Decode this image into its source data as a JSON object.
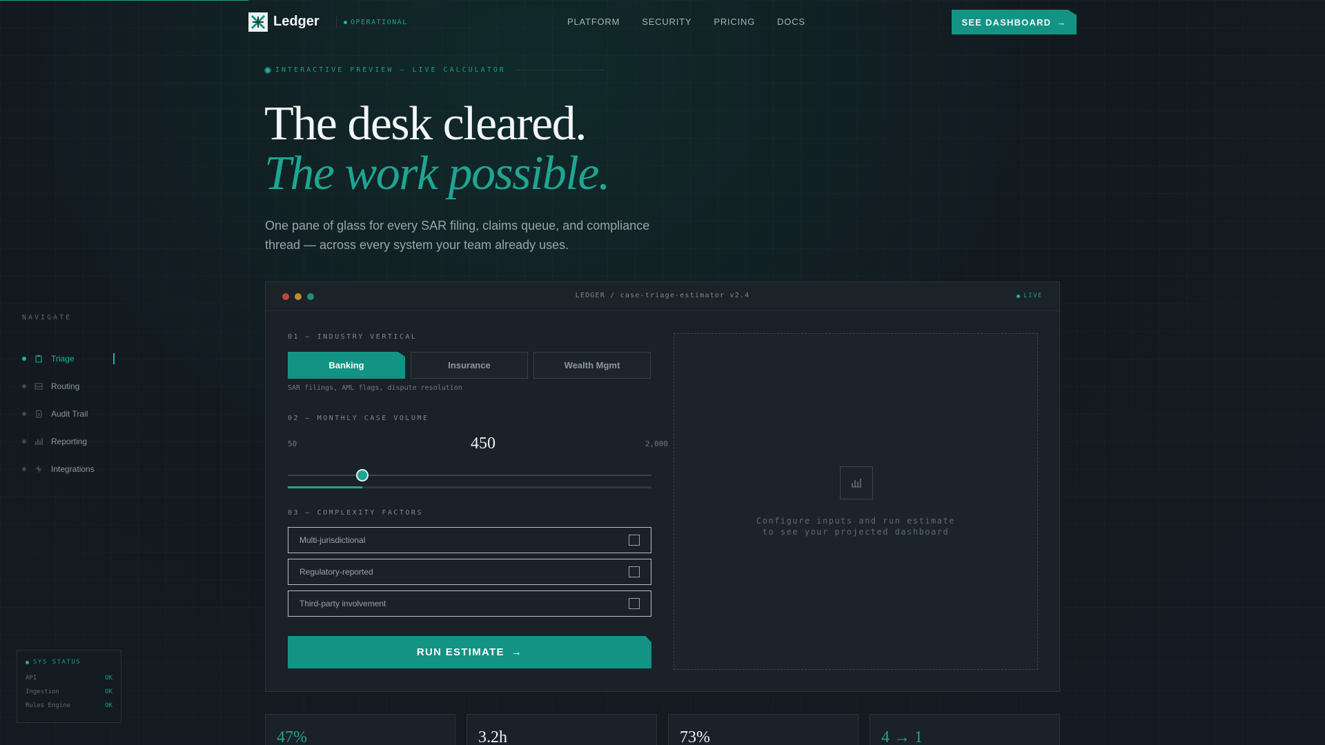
{
  "header": {
    "brand": "Ledger",
    "status": "OPERATIONAL",
    "nav": [
      "PLATFORM",
      "SECURITY",
      "PRICING",
      "DOCS"
    ],
    "cta": "SEE DASHBOARD"
  },
  "hero": {
    "eyebrow": "INTERACTIVE PREVIEW — LIVE CALCULATOR",
    "title_line1": "The desk cleared.",
    "title_line2": "The work possible.",
    "lede": "One pane of glass for every SAR filing, claims queue, and compliance thread — across every system your team already uses."
  },
  "sidebar": {
    "label": "NAVIGATE",
    "items": [
      {
        "label": "Triage",
        "icon": "clipboard-icon",
        "active": true
      },
      {
        "label": "Routing",
        "icon": "inbox-icon",
        "active": false
      },
      {
        "label": "Audit Trail",
        "icon": "document-icon",
        "active": false
      },
      {
        "label": "Reporting",
        "icon": "bar-chart-icon",
        "active": false
      },
      {
        "label": "Integrations",
        "icon": "plug-icon",
        "active": false
      }
    ],
    "sys_status": {
      "title": "SYS STATUS",
      "rows": [
        {
          "name": "API",
          "value": "OK"
        },
        {
          "name": "Ingestion",
          "value": "OK"
        },
        {
          "name": "Rules Engine",
          "value": "OK"
        }
      ]
    }
  },
  "panel": {
    "title": "LEDGER / case-triage-estimator v2.4",
    "live": "LIVE",
    "section1": "01 — INDUSTRY VERTICAL",
    "tabs": [
      "Banking",
      "Insurance",
      "Wealth Mgmt"
    ],
    "active_tab": "Banking",
    "tab_hint": "SAR filings, AML flags, dispute resolution",
    "section2": "02 — MONTHLY CASE VOLUME",
    "volume": {
      "min": "50",
      "max": "2,000",
      "value": "450",
      "slider_fraction": 0.205
    },
    "section3": "03 — COMPLEXITY FACTORS",
    "factors": [
      {
        "label": "Multi-jurisdictional",
        "checked": false
      },
      {
        "label": "Regulatory-reported",
        "checked": false
      },
      {
        "label": "Third-party involvement",
        "checked": false
      }
    ],
    "run": "RUN ESTIMATE",
    "preview_line1": "Configure inputs and run estimate",
    "preview_line2": "to see your projected dashboard"
  },
  "stats": [
    "47%",
    "3.2h",
    "73%",
    "4 → 1"
  ],
  "colors": {
    "accent": "#139384",
    "accent_text": "#1fa592",
    "background": "#141a21",
    "light_red": "#c0443c",
    "light_amber": "#c08a2a",
    "light_green": "#1f8f7a"
  }
}
